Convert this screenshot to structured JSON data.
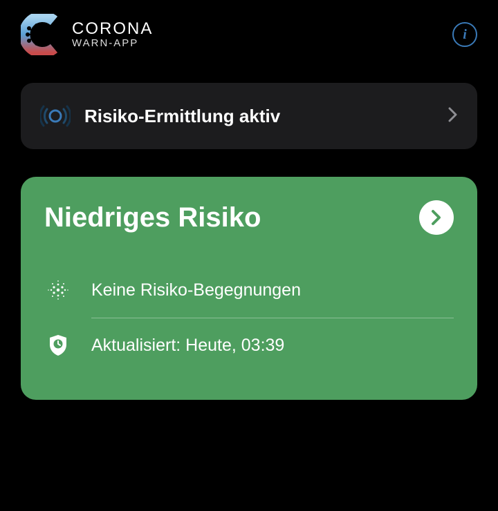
{
  "header": {
    "brand_title": "CORONA",
    "brand_subtitle": "WARN-APP"
  },
  "status_card": {
    "label": "Risiko-Ermittlung aktiv"
  },
  "risk_card": {
    "title": "Niedriges Risiko",
    "encounters_label": "Keine Risiko-Begegnungen",
    "updated_label": "Aktualisiert: Heute, 03:39"
  },
  "colors": {
    "risk_low": "#4e9e5f",
    "info_accent": "#3a7ab8"
  }
}
